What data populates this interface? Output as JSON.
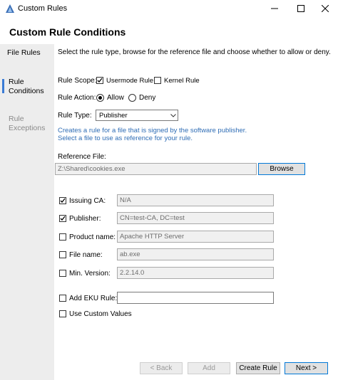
{
  "window": {
    "title": "Custom Rules"
  },
  "header": {
    "title": "Custom Rule Conditions"
  },
  "sidebar": {
    "items": [
      {
        "label": "File Rules"
      },
      {
        "label_line1": "Rule",
        "label_line2": "Conditions"
      },
      {
        "label_line1": "Rule",
        "label_line2": "Exceptions"
      }
    ]
  },
  "main": {
    "description": "Select the rule type, browse for the reference file and choose whether to allow or deny.",
    "rule_scope": {
      "label": "Rule Scope:",
      "usermode": "Usermode Rule",
      "kernel": "Kernel Rule"
    },
    "rule_action": {
      "label": "Rule Action:",
      "allow": "Allow",
      "deny": "Deny"
    },
    "rule_type": {
      "label": "Rule Type:",
      "selected": "Publisher"
    },
    "hint_line1": "Creates a rule for a file that is signed by the software publisher.",
    "hint_line2": "Select a file to use as reference for your rule.",
    "reference": {
      "label": "Reference File:",
      "path": "Z:\\Shared\\cookies.exe",
      "browse": "Browse"
    },
    "conditions": [
      {
        "label": "Issuing CA:",
        "value": "N/A",
        "checked": true
      },
      {
        "label": "Publisher:",
        "value": "CN=test-CA, DC=test",
        "checked": true
      },
      {
        "label": "Product name:",
        "value": "Apache HTTP Server",
        "checked": false
      },
      {
        "label": "File name:",
        "value": "ab.exe",
        "checked": false
      },
      {
        "label": "Min. Version:",
        "value": "2.2.14.0",
        "checked": false
      }
    ],
    "eku": {
      "label": "Add EKU Rule:",
      "value": ""
    },
    "custom_values": {
      "label": "Use Custom Values"
    }
  },
  "footer": {
    "back": "< Back",
    "add": "Add",
    "create": "Create Rule",
    "next": "Next >"
  }
}
